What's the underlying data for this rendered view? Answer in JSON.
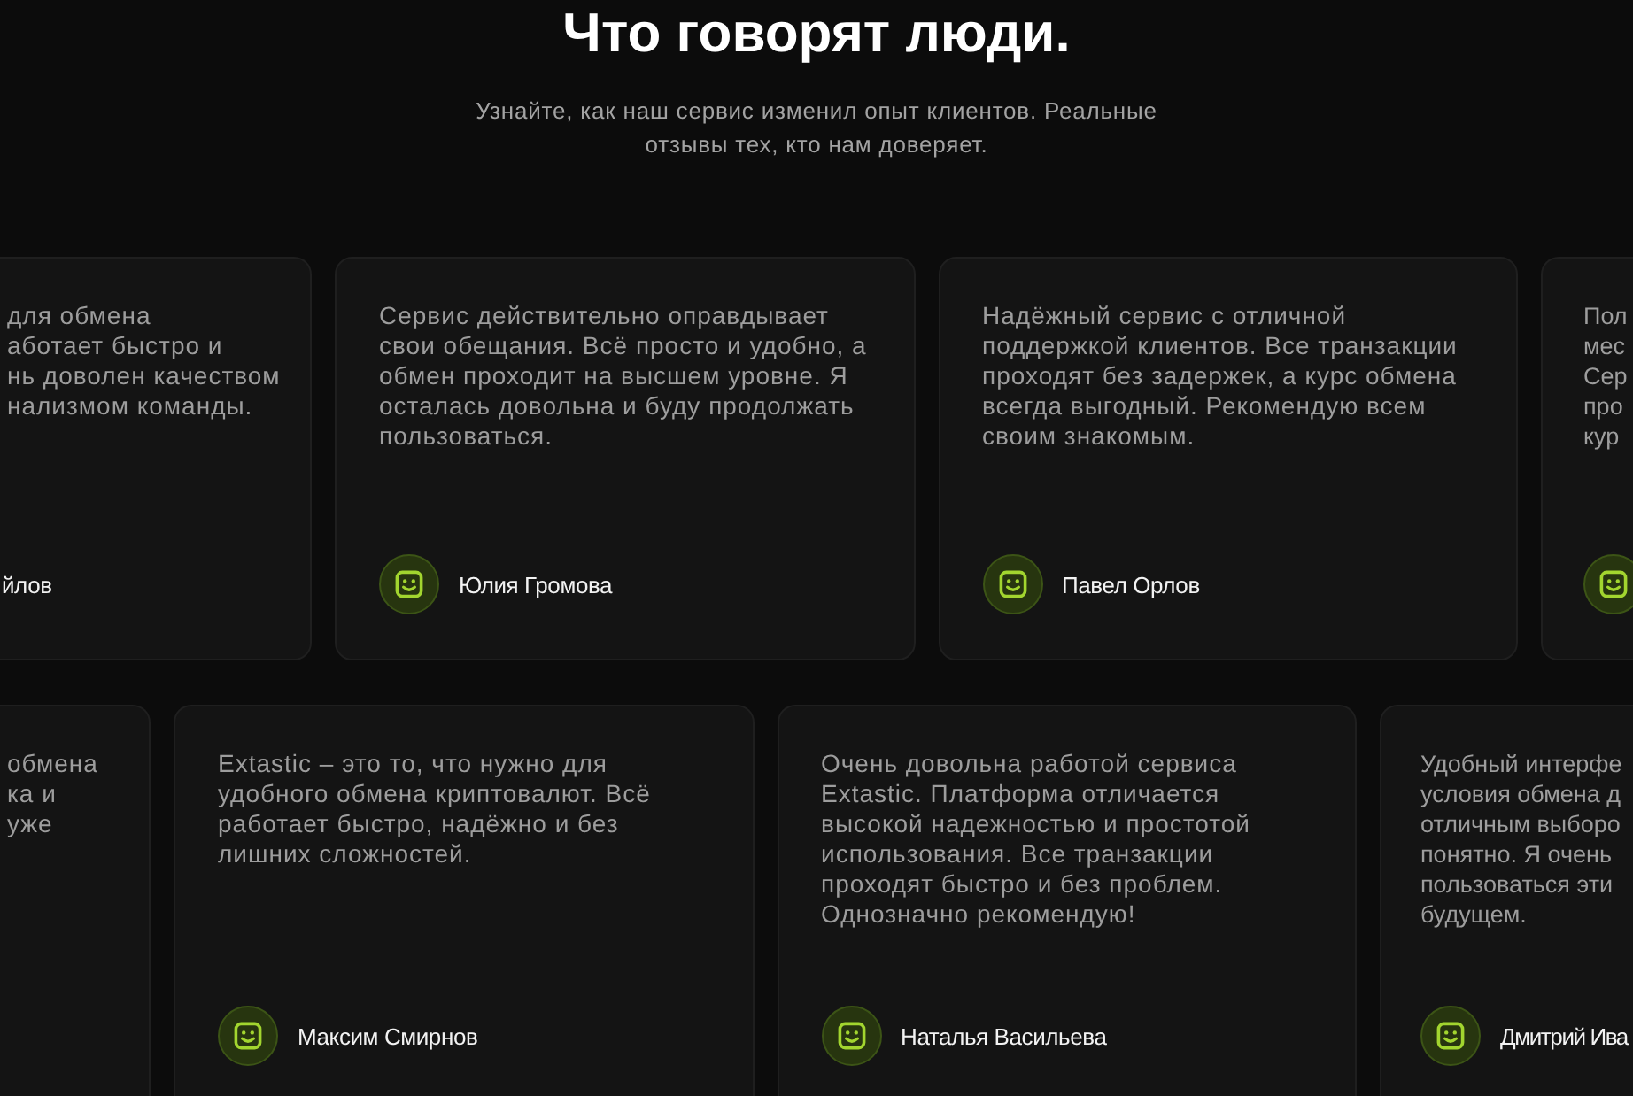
{
  "header": {
    "title": "Что говорят люди.",
    "subtitle": "Узнайте, как наш сервис изменил опыт клиентов. Реальные отзывы тех, кто нам доверяет."
  },
  "rows": [
    {
      "cards": [
        {
          "kind": "cut_left",
          "text": "для обмена\nаботает быстро и\nнь доволен качеством\nнализмом команды.",
          "author": "йлов"
        },
        {
          "kind": "full",
          "text": "Сервис действительно оправдывает свои обещания. Всё просто и удобно, а обмен проходит на высшем уровне. Я осталась довольна и буду продолжать пользоваться.",
          "author": "Юлия Громова"
        },
        {
          "kind": "full",
          "text": "Надёжный сервис с отличной поддержкой клиентов. Все транзакции проходят без задержек, а курс обмена всегда выгодный. Рекомендую всем своим знакомым.",
          "author": "Павел Орлов"
        },
        {
          "kind": "cut_right",
          "text": "Пол\nмес\nСер\nпро\nкур"
        }
      ]
    },
    {
      "cards": [
        {
          "kind": "cut_left",
          "text": "обмена\nка и\nуже"
        },
        {
          "kind": "full",
          "text": "Extastic – это то, что нужно для удобного обмена криптовалют. Всё работает быстро, надёжно и без лишних сложностей.",
          "author": "Максим Смирнов"
        },
        {
          "kind": "full",
          "text": "Очень довольна работой сервиса Extastic. Платформа отличается высокой надежностью и простотой использования. Все транзакции проходят быстро и без проблем. Однозначно рекомендую!",
          "author": "Наталья Васильева"
        },
        {
          "kind": "cut_right",
          "text": "Удобный интерфе\nусловия обмена д\nотличным выборо\nпонятно. Я очень\nпользоваться эти\nбудущем.",
          "author": "Дмитрий Ива"
        }
      ]
    }
  ]
}
